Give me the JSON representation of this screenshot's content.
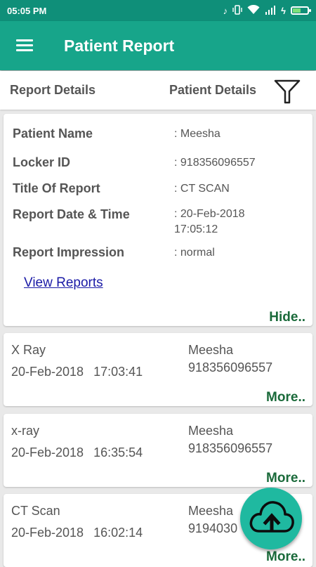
{
  "status_bar": {
    "time": "05:05 PM",
    "icons": [
      "music-note-icon",
      "vibrate-icon",
      "wifi-icon",
      "signal-icon",
      "battery-icon"
    ]
  },
  "app_bar": {
    "title": "Patient Report",
    "menu_icon": "hamburger-menu-icon",
    "color": "#17a58a"
  },
  "tabs": {
    "report_details": "Report Details",
    "patient_details": "Patient Details",
    "filter_icon": "filter-funnel-icon"
  },
  "detail_card": {
    "fields": [
      {
        "label": "Patient Name",
        "value": ": Meesha"
      },
      {
        "label": "Locker ID",
        "value": ": 918356096557"
      },
      {
        "label": "Title Of Report",
        "value": ": CT SCAN"
      },
      {
        "label": "Report Date & Time",
        "value": ": 20-Feb-2018",
        "value2": "17:05:12"
      },
      {
        "label": "Report Impression",
        "value": ": normal"
      }
    ],
    "view_reports_link": "View Reports",
    "hide_link": "Hide.."
  },
  "reports": [
    {
      "title": "X Ray",
      "date": "20-Feb-2018",
      "time": "17:03:41",
      "name": "Meesha",
      "id": "918356096557",
      "more": "More.."
    },
    {
      "title": "x-ray",
      "date": "20-Feb-2018",
      "time": "16:35:54",
      "name": "Meesha",
      "id": "918356096557",
      "more": "More.."
    },
    {
      "title": "CT Scan",
      "date": "20-Feb-2018",
      "time": "16:02:14",
      "name": "Meesha",
      "id": "9194030",
      "more": "More.."
    }
  ],
  "fab": {
    "icon": "cloud-upload-icon",
    "color": "#1fb9a0"
  }
}
